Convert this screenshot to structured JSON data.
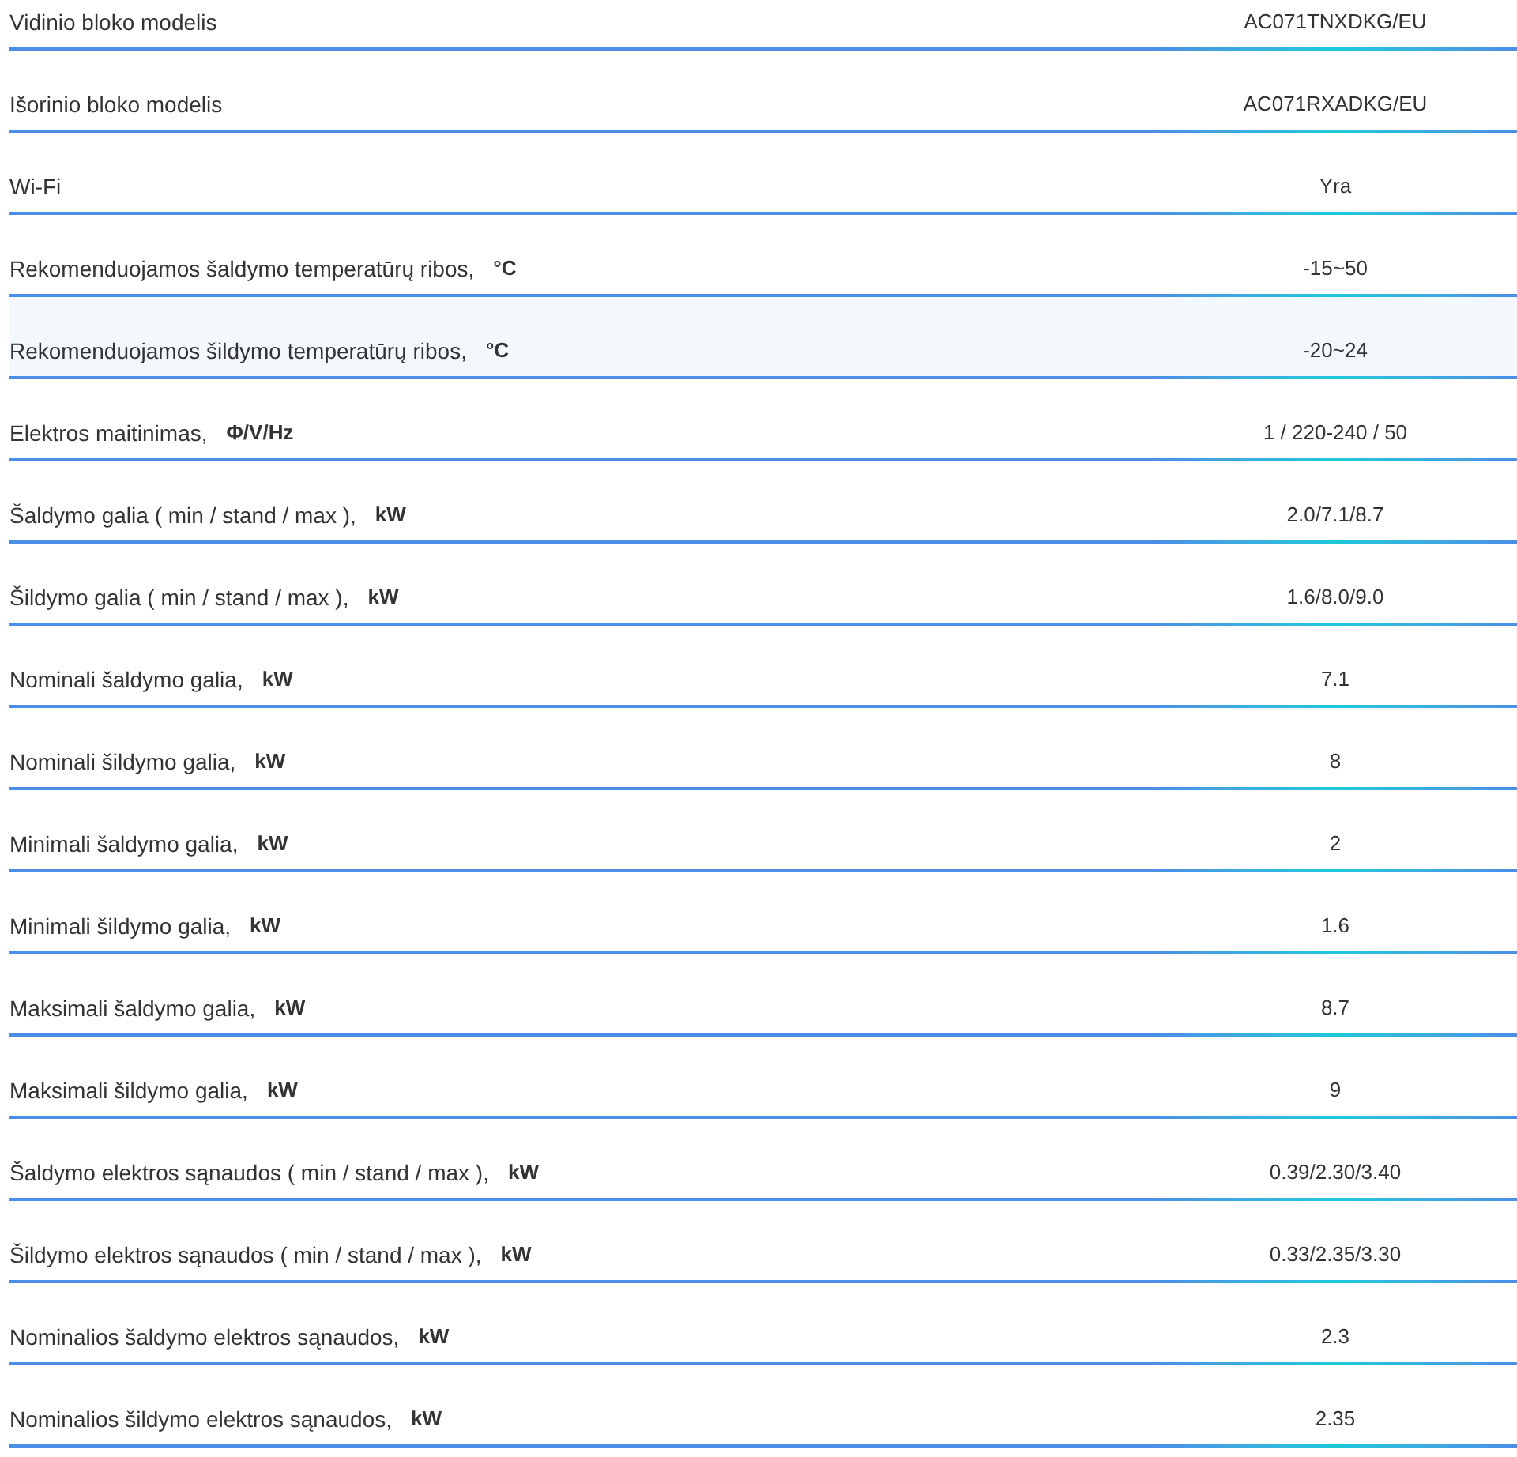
{
  "specs": [
    {
      "label": "Vidinio bloko modelis",
      "value": "AC071TNXDKG/EU",
      "highlighted": false
    },
    {
      "label": "Išorinio bloko modelis",
      "value": "AC071RXADKG/EU",
      "highlighted": false
    },
    {
      "label": "Wi-Fi",
      "value": "Yra",
      "highlighted": false
    },
    {
      "label": "Rekomenduojamos šaldymo temperatūrų ribos,",
      "unit": "°C",
      "value": "-15~50",
      "highlighted": false
    },
    {
      "label": "Rekomenduojamos šildymo temperatūrų ribos,",
      "unit": "°C",
      "value": "-20~24",
      "highlighted": true
    },
    {
      "label": "Elektros maitinimas,",
      "unit": "Φ/V/Hz",
      "value": "1 / 220-240 / 50",
      "highlighted": false
    },
    {
      "label": "Šaldymo galia ( min / stand / max ),",
      "unit": "kW",
      "value": "2.0/7.1/8.7",
      "highlighted": false
    },
    {
      "label": "Šildymo galia ( min / stand / max ),",
      "unit": "kW",
      "value": "1.6/8.0/9.0",
      "highlighted": false
    },
    {
      "label": "Nominali šaldymo galia,",
      "unit": "kW",
      "value": "7.1",
      "highlighted": false
    },
    {
      "label": "Nominali šildymo galia,",
      "unit": "kW",
      "value": "8",
      "highlighted": false
    },
    {
      "label": "Minimali šaldymo galia,",
      "unit": "kW",
      "value": "2",
      "highlighted": false
    },
    {
      "label": "Minimali šildymo galia,",
      "unit": "kW",
      "value": "1.6",
      "highlighted": false
    },
    {
      "label": "Maksimali šaldymo galia,",
      "unit": "kW",
      "value": "8.7",
      "highlighted": false
    },
    {
      "label": "Maksimali šildymo galia,",
      "unit": "kW",
      "value": "9",
      "highlighted": false
    },
    {
      "label": "Šaldymo elektros sąnaudos ( min / stand / max ),",
      "unit": "kW",
      "value": "0.39/2.30/3.40",
      "highlighted": false
    },
    {
      "label": "Šildymo elektros sąnaudos ( min / stand / max ),",
      "unit": "kW",
      "value": "0.33/2.35/3.30",
      "highlighted": false
    },
    {
      "label": "Nominalios šaldymo elektros sąnaudos,",
      "unit": "kW",
      "value": "2.3",
      "highlighted": false
    },
    {
      "label": "Nominalios šildymo elektros sąnaudos,",
      "unit": "kW",
      "value": "2.35",
      "highlighted": false
    }
  ]
}
